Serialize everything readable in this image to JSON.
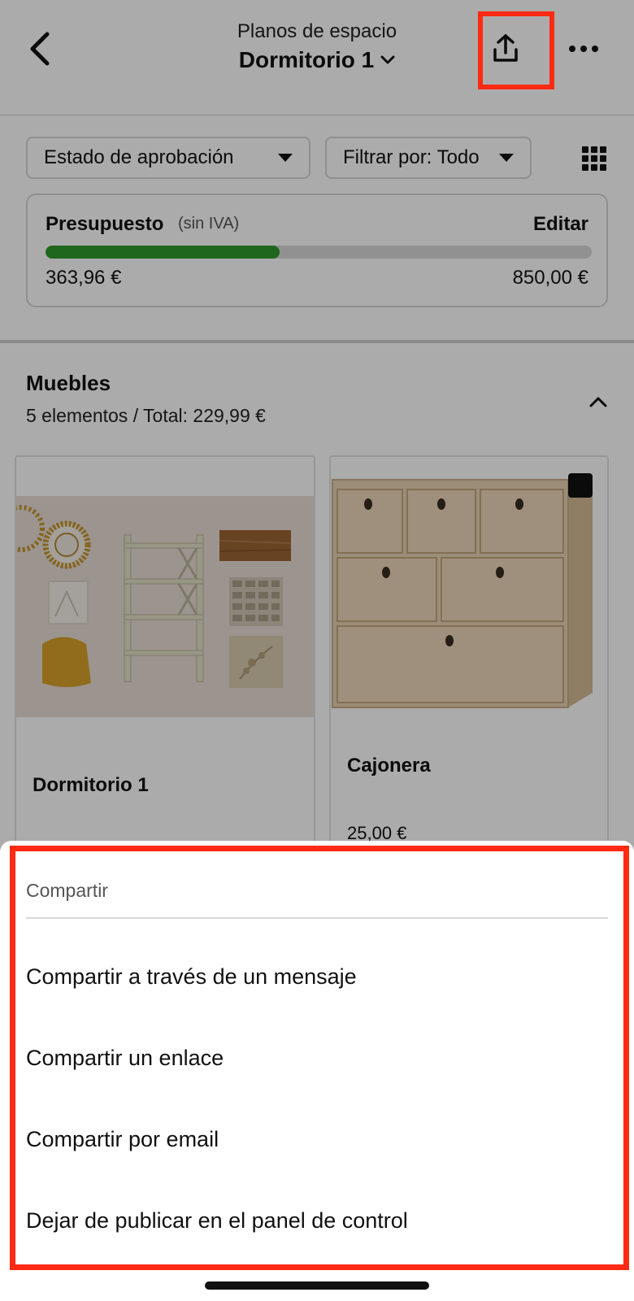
{
  "header": {
    "subtitle": "Planos de espacio",
    "title": "Dormitorio 1",
    "icons": [
      "back-arrow-icon",
      "chevron-down-icon",
      "share-icon",
      "more-icon"
    ]
  },
  "filters": {
    "approval": "Estado de aprobación",
    "filter_by": "Filtrar por: Todo",
    "grid_icon": "grid-view-icon"
  },
  "budget": {
    "title": "Presupuesto",
    "note": "(sin IVA)",
    "edit_label": "Editar",
    "spent": "363,96 €",
    "total": "850,00 €",
    "progress_fraction": 0.428,
    "bar_color": "#2e9a2a"
  },
  "section": {
    "title": "Muebles",
    "summary": "5 elementos / Total: 229,99 €"
  },
  "cards": [
    {
      "name": "Dormitorio 1",
      "image": "moodboard-collage"
    },
    {
      "name": "Cajonera",
      "price": "25,00 €",
      "image": "wooden-drawer-chest"
    }
  ],
  "share_sheet": {
    "title": "Compartir",
    "options": [
      "Compartir a través de un mensaje",
      "Compartir un enlace",
      "Compartir por email",
      "Dejar de publicar en el panel de control"
    ]
  },
  "colors": {
    "highlight": "#ff2a12",
    "accent_green": "#2e9a2a"
  }
}
